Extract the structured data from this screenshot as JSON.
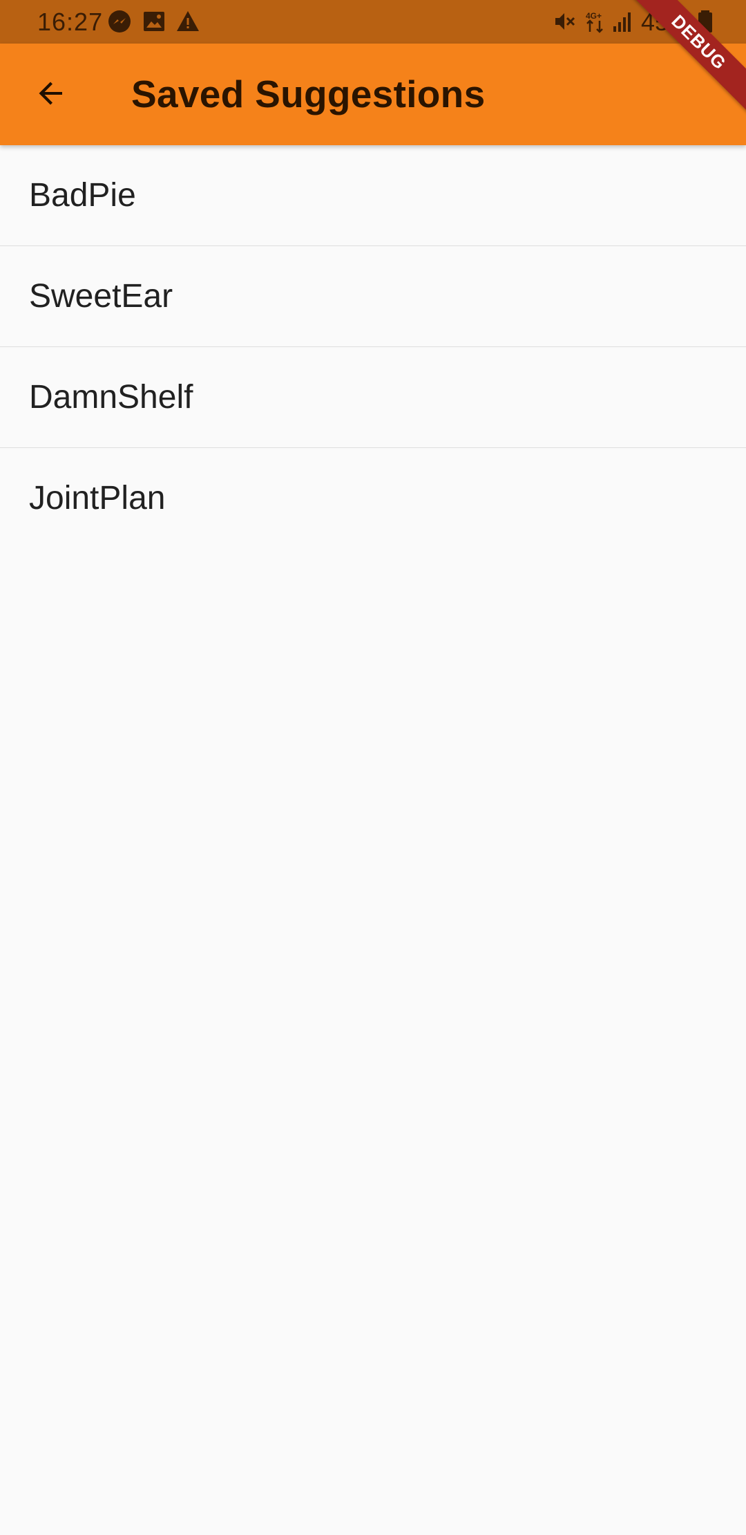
{
  "status_bar": {
    "time": "16:27",
    "battery": "45%",
    "network": "4G+",
    "icons": [
      "messenger-icon",
      "gallery-icon",
      "warning-icon",
      "mute-icon",
      "data-arrows-icon",
      "signal-icon",
      "battery-icon"
    ]
  },
  "app_bar": {
    "title": "Saved Suggestions",
    "back_icon": "arrow-back-icon"
  },
  "debug_banner": {
    "label": "DEBUG"
  },
  "saved_list": {
    "items": [
      {
        "label": "BadPie"
      },
      {
        "label": "SweetEar"
      },
      {
        "label": "DamnShelf"
      },
      {
        "label": "JointPlan"
      }
    ]
  },
  "colors": {
    "app_bar": "#f5821a",
    "status_bar": "#b86112",
    "background": "#fafafa",
    "debug_ribbon": "#a3241f",
    "divider": "#dedede"
  }
}
